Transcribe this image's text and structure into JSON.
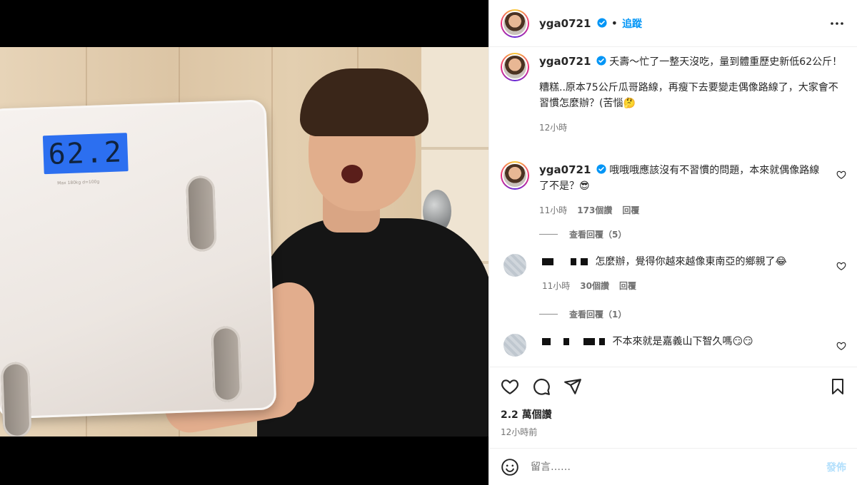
{
  "post": {
    "username": "yga0721",
    "follow_label": "追蹤",
    "separator": "•",
    "scale_reading": "62.2",
    "scale_spec": "Max 180kg d=100g"
  },
  "caption": {
    "username": "yga0721",
    "text1": "夭壽～忙了一整天沒吃，量到體重歷史新低62公斤！",
    "text2": "糟糕..原本75公斤瓜哥路線，再瘦下去要變走偶像路線了，大家會不習慣怎麼辦？(苦惱🤔",
    "time": "12小時"
  },
  "comments": [
    {
      "username": "yga0721",
      "text": "哦哦哦應該沒有不習慣的問題，本來就偶像路線了不是？😎",
      "time": "11小時",
      "likes": "173個讚",
      "reply": "回覆",
      "view_replies": "查看回覆（5）"
    },
    {
      "username": "",
      "text": "怎麼辦，覺得你越來越像東南亞的鄉親了😂",
      "time": "11小時",
      "likes": "30個讚",
      "reply": "回覆",
      "view_replies": "查看回覆（1）"
    },
    {
      "username": "",
      "text": "不本來就是嘉義山下智久嗎😏😏"
    }
  ],
  "stats": {
    "likes": "2.2 萬個讚",
    "time": "12小時前"
  },
  "composer": {
    "placeholder": "留言……",
    "post_label": "發佈"
  },
  "icons": {
    "verified": "verified-badge-icon",
    "more": "more-options-icon",
    "like": "heart-icon",
    "comment": "comment-icon",
    "share": "send-icon",
    "save": "bookmark-icon",
    "emoji": "emoji-icon"
  },
  "colors": {
    "accent": "#0095f6",
    "verified": "#0095f6",
    "muted": "#737373",
    "post_disabled": "#b2dffc"
  }
}
